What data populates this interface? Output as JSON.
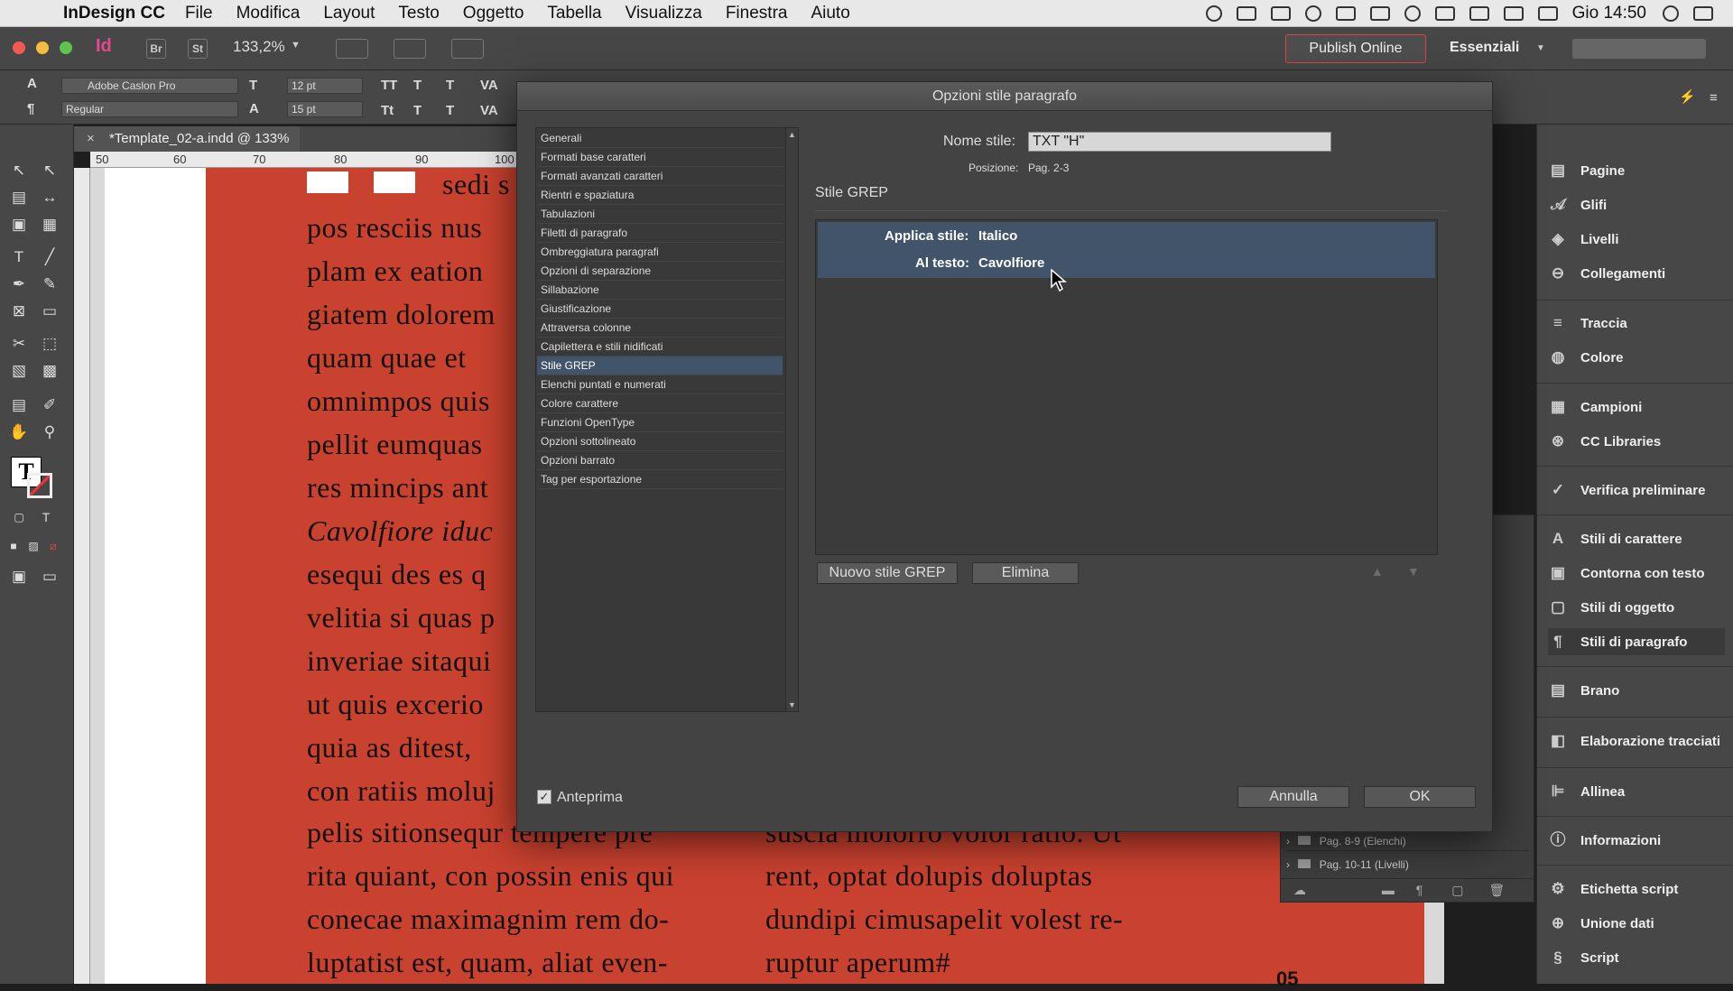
{
  "menubar": {
    "app": "InDesign CC",
    "items": [
      "File",
      "Modifica",
      "Layout",
      "Testo",
      "Oggetto",
      "Tabella",
      "Visualizza",
      "Finestra",
      "Aiuto"
    ],
    "clock": "Gio 14:50"
  },
  "appbar": {
    "app_icon": "Id",
    "bridge": "Br",
    "stock": "St",
    "zoom": "133,2%",
    "publish": "Publish Online",
    "workspace": "Essenziali"
  },
  "ctrlbar": {
    "font": "Adobe Caslon Pro",
    "style": "Regular",
    "size": "12 pt",
    "leading": "15 pt"
  },
  "document": {
    "tab": "*Template_02-a.indd @ 133%",
    "ruler_labels": [
      "50",
      "60",
      "70",
      "80",
      "90",
      "100"
    ],
    "left_column": [
      "sedi s",
      "pos resciis nus",
      "plam ex eation",
      "giatem dolorem",
      "quam quae et",
      "omnimpos quis",
      "pellit eumquas",
      "res mincips ant",
      "Cavolfiore iduc",
      "esequi des es q",
      "velitia si quas p",
      "inveriae sitaqui",
      "ut quis excerio",
      "quia as ditest,",
      "con ratiis moluj",
      "pelis sitionsequr tempere pre",
      "rita quiant, con possin enis qui",
      "conecae maximagnim rem do-",
      "luptatist est, quam, aliat even-"
    ],
    "right_column": [
      "suscia molorro volor ratio. Ut",
      "rent, optat dolupis doluptas",
      "dundipi cimusapelit volest re-",
      "ruptur aperum#"
    ],
    "page_number": "05"
  },
  "pages_panel": {
    "rows": [
      "Pag. 8-9 (Elenchi)",
      "Pag. 10-11 (Livelli)"
    ]
  },
  "dock": {
    "items": [
      {
        "label": "Pagine",
        "icon": "pages-icon"
      },
      {
        "label": "Glifi",
        "icon": "glyphs-icon"
      },
      {
        "label": "Livelli",
        "icon": "layers-icon"
      },
      {
        "label": "Collegamenti",
        "icon": "links-icon"
      },
      {
        "label": "Traccia",
        "icon": "stroke-icon"
      },
      {
        "label": "Colore",
        "icon": "color-icon"
      },
      {
        "label": "Campioni",
        "icon": "swatches-icon"
      },
      {
        "label": "CC Libraries",
        "icon": "cc-libraries-icon"
      },
      {
        "label": "Verifica preliminare",
        "icon": "preflight-icon"
      },
      {
        "label": "Stili di carattere",
        "icon": "character-styles-icon"
      },
      {
        "label": "Contorna con testo",
        "icon": "text-wrap-icon"
      },
      {
        "label": "Stili di oggetto",
        "icon": "object-styles-icon"
      },
      {
        "label": "Stili di paragrafo",
        "icon": "paragraph-styles-icon"
      },
      {
        "label": "Brano",
        "icon": "story-icon"
      },
      {
        "label": "Elaborazione tracciati",
        "icon": "pathfinder-icon"
      },
      {
        "label": "Allinea",
        "icon": "align-icon"
      },
      {
        "label": "Informazioni",
        "icon": "info-icon"
      },
      {
        "label": "Etichetta script",
        "icon": "script-label-icon"
      },
      {
        "label": "Unione dati",
        "icon": "data-merge-icon"
      },
      {
        "label": "Script",
        "icon": "scripts-icon"
      }
    ]
  },
  "dialog": {
    "title": "Opzioni stile paragrafo",
    "categories": [
      "Generali",
      "Formati base caratteri",
      "Formati avanzati caratteri",
      "Rientri e spaziatura",
      "Tabulazioni",
      "Filetti di paragrafo",
      "Ombreggiatura paragrafi",
      "Opzioni di separazione",
      "Sillabazione",
      "Giustificazione",
      "Attraversa colonne",
      "Capilettera e stili nidificati",
      "Stile GREP",
      "Elenchi puntati e numerati",
      "Colore carattere",
      "Funzioni OpenType",
      "Opzioni sottolineato",
      "Opzioni barrato",
      "Tag per esportazione"
    ],
    "selected_category": "Stile GREP",
    "style_name_label": "Nome stile:",
    "style_name_value": "TXT \"H\"",
    "position_label": "Posizione:",
    "position_value": "Pag. 2-3",
    "section_title": "Stile GREP",
    "grep_apply_label": "Applica stile:",
    "grep_apply_value": "Italico",
    "grep_text_label": "Al testo:",
    "grep_text_value": "Cavolfiore",
    "new_grep_button": "Nuovo stile GREP",
    "delete_button": "Elimina",
    "preview_label": "Anteprima",
    "preview_checked": true,
    "cancel_button": "Annulla",
    "ok_button": "OK"
  }
}
